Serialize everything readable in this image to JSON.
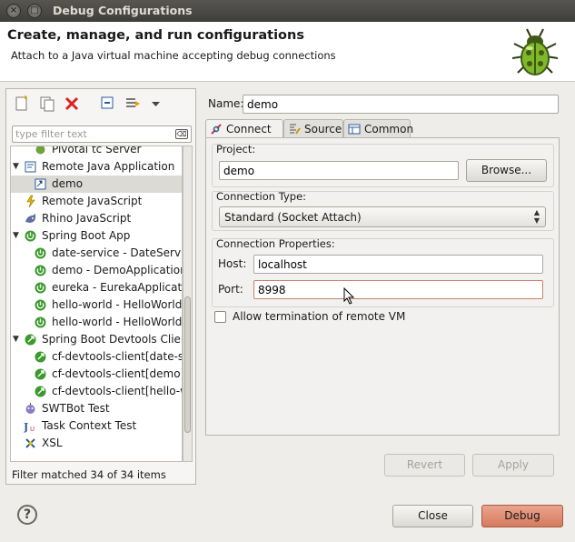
{
  "window": {
    "title": "Debug Configurations"
  },
  "header": {
    "title": "Create, manage, and run configurations",
    "subtitle": "Attach to a Java virtual machine accepting debug connections"
  },
  "toolbar": {
    "icons": [
      "new-configuration-icon",
      "duplicate-icon",
      "delete-icon",
      "collapse-all-icon",
      "filter-icon",
      "view-menu-icon"
    ]
  },
  "filter": {
    "placeholder": "type filter text"
  },
  "tree": {
    "items": [
      {
        "label": "Pivotal tc Server",
        "level": 1,
        "icon": "pivotal-tc-server-icon"
      },
      {
        "label": "Remote Java Application",
        "level": 0,
        "expanded": true,
        "icon": "remote-java-app-icon"
      },
      {
        "label": "demo",
        "level": 1,
        "selected": true,
        "icon": "remote-java-config-icon"
      },
      {
        "label": "Remote JavaScript",
        "level": 0,
        "icon": "remote-javascript-icon"
      },
      {
        "label": "Rhino JavaScript",
        "level": 0,
        "icon": "rhino-javascript-icon"
      },
      {
        "label": "Spring Boot App",
        "level": 0,
        "expanded": true,
        "icon": "spring-boot-icon"
      },
      {
        "label": "date-service - DateServiceApplication",
        "level": 1,
        "icon": "spring-boot-icon"
      },
      {
        "label": "demo - DemoApplication",
        "level": 1,
        "icon": "spring-boot-icon"
      },
      {
        "label": "eureka - EurekaApplication",
        "level": 1,
        "icon": "spring-boot-icon"
      },
      {
        "label": "hello-world - HelloWorldApplication",
        "level": 1,
        "icon": "spring-boot-icon"
      },
      {
        "label": "hello-world - HelloWorldApplication",
        "level": 1,
        "icon": "spring-boot-icon"
      },
      {
        "label": "Spring Boot Devtools Client",
        "level": 0,
        "expanded": true,
        "icon": "devtools-client-icon"
      },
      {
        "label": "cf-devtools-client[date-service]",
        "level": 1,
        "icon": "devtools-client-icon"
      },
      {
        "label": "cf-devtools-client[demo]",
        "level": 1,
        "icon": "devtools-client-icon"
      },
      {
        "label": "cf-devtools-client[hello-world]",
        "level": 1,
        "icon": "devtools-client-icon"
      },
      {
        "label": "SWTBot Test",
        "level": 0,
        "icon": "swtbot-icon"
      },
      {
        "label": "Task Context Test",
        "level": 0,
        "icon": "junit-icon"
      },
      {
        "label": "XSL",
        "level": 0,
        "icon": "xsl-icon"
      }
    ]
  },
  "filter_status": "Filter matched 34 of 34 items",
  "config": {
    "name_label": "Name:",
    "name_value": "demo",
    "tabs": [
      {
        "label": "Connect",
        "active": true,
        "icon": "connect-icon"
      },
      {
        "label": "Source",
        "active": false,
        "icon": "source-icon"
      },
      {
        "label": "Common",
        "active": false,
        "icon": "common-icon"
      }
    ],
    "project_group": "Project:",
    "project_value": "demo",
    "browse_label": "Browse...",
    "connection_type_group": "Connection Type:",
    "connection_type_value": "Standard (Socket Attach)",
    "connection_props_group": "Connection Properties:",
    "host_label": "Host:",
    "host_value": "localhost",
    "port_label": "Port:",
    "port_value": "8998",
    "allow_termination_label": "Allow termination of remote VM",
    "allow_termination_checked": false,
    "revert_label": "Revert",
    "apply_label": "Apply"
  },
  "footer": {
    "help_label": "?",
    "close_label": "Close",
    "debug_label": "Debug"
  }
}
